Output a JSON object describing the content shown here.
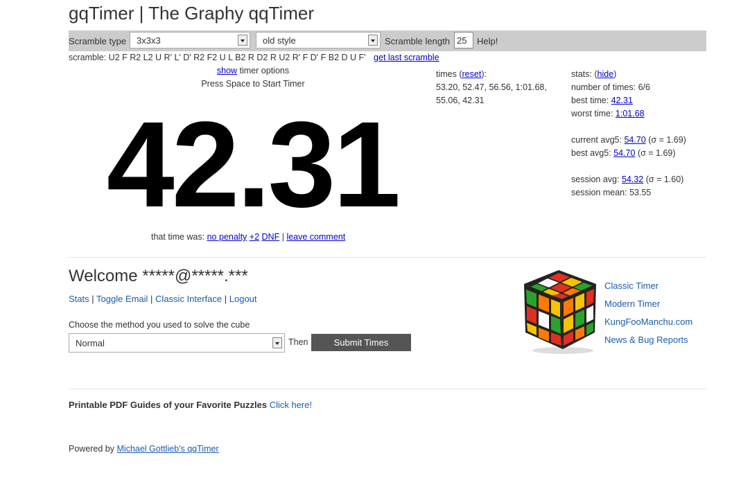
{
  "header": {
    "title": "gqTimer | The Graphy qqTimer"
  },
  "toolbar": {
    "scramble_type_label": "Scramble type",
    "scramble_type_value": "3x3x3",
    "style_value": "old style",
    "scramble_length_label": "Scramble length",
    "scramble_length_value": "25",
    "help_label": "Help!"
  },
  "scramble": {
    "label": "scramble:",
    "moves": "U2 F R2 L2 U R' L' D' R2 F2 U L B2 R D2 R U2 R' F D' F B2 D U F'",
    "get_last": "get last scramble"
  },
  "timer": {
    "show_link": "show",
    "options_text": "timer options",
    "instruction": "Press Space to Start Timer",
    "display": "42.31",
    "that_time_label": "that time was:",
    "no_penalty": "no penalty",
    "plus2": "+2",
    "dnf": "DNF",
    "separator": "|",
    "leave_comment": "leave comment"
  },
  "times": {
    "label": "times",
    "reset": "reset",
    "list_line1": "53.20, 52.47, 56.56, 1:01.68,",
    "list_line2": "55.06, 42.31"
  },
  "stats": {
    "label": "stats:",
    "hide": "hide",
    "number_of_times_label": "number of times:",
    "number_of_times": "6/6",
    "best_time_label": "best time:",
    "best_time": "42.31",
    "worst_time_label": "worst time:",
    "worst_time": "1:01.68",
    "current_avg5_label": "current avg5:",
    "current_avg5": "54.70",
    "current_avg5_sigma": "(σ = 1.69)",
    "best_avg5_label": "best avg5:",
    "best_avg5": "54.70",
    "best_avg5_sigma": "(σ = 1.69)",
    "session_avg_label": "session avg:",
    "session_avg": "54.32",
    "session_avg_sigma": "(σ = 1.60)",
    "session_mean_label": "session mean:",
    "session_mean": "53.55"
  },
  "account": {
    "welcome": "Welcome *****@*****.***",
    "links": [
      "Stats",
      "Toggle Email",
      "Classic Interface",
      "Logout"
    ],
    "method_label": "Choose the method you used to solve the cube",
    "method_value": "Normal",
    "then_label": "Then",
    "submit_label": "Submit Times"
  },
  "side_links": [
    "Classic Timer",
    "Modern Timer",
    "KungFooManchu.com",
    "News & Bug Reports"
  ],
  "footer": {
    "pdf_text": "Printable PDF Guides of your Favorite Puzzles",
    "pdf_link": "Click here!",
    "powered_by": "Powered by",
    "powered_link": "Michael Gottlieb's qqTimer"
  },
  "colors": {
    "toolbar_bg": "#cccccc",
    "link": "#0000cc",
    "link_alt": "#1a5cb0",
    "submit_bg": "#555555"
  }
}
